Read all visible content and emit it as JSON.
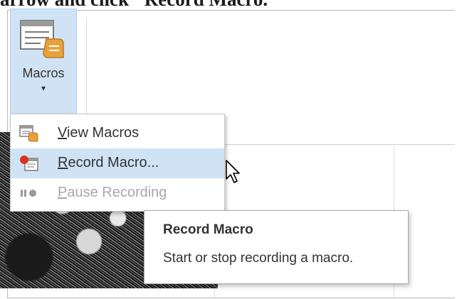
{
  "caption": "arrow and click \"Record Macro.\"",
  "ribbon": {
    "macros_label": "Macros",
    "macros_arrow": "▾"
  },
  "menu": {
    "items": [
      {
        "label_accel": "V",
        "label_rest": "iew Macros",
        "icon": "view-macros-icon",
        "state": "normal"
      },
      {
        "label_accel": "R",
        "label_rest": "ecord Macro...",
        "icon": "record-macro-icon",
        "state": "highlighted"
      },
      {
        "label_accel": "P",
        "label_rest": "ause Recording",
        "icon": "pause-recording-icon",
        "state": "disabled"
      }
    ]
  },
  "tooltip": {
    "title": "Record Macro",
    "description": "Start or stop recording a macro."
  },
  "colors": {
    "highlight": "#cfe3f5",
    "record_red": "#d9331f",
    "macro_orange": "#e8a23a"
  }
}
